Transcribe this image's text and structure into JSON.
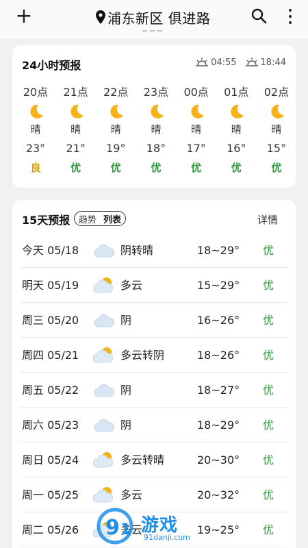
{
  "header": {
    "location": "浦东新区 俱进路"
  },
  "hourly": {
    "title": "24小时预报",
    "sunrise": "04:55",
    "sunset": "18:44",
    "hours": [
      {
        "time": "20点",
        "desc": "晴",
        "temp": "23°",
        "aqi": "良",
        "aqi_color": "#d4a200"
      },
      {
        "time": "21点",
        "desc": "晴",
        "temp": "21°",
        "aqi": "优",
        "aqi_color": "#2e9a3c"
      },
      {
        "time": "22点",
        "desc": "晴",
        "temp": "19°",
        "aqi": "优",
        "aqi_color": "#2e9a3c"
      },
      {
        "time": "23点",
        "desc": "晴",
        "temp": "18°",
        "aqi": "优",
        "aqi_color": "#2e9a3c"
      },
      {
        "time": "00点",
        "desc": "晴",
        "temp": "17°",
        "aqi": "优",
        "aqi_color": "#2e9a3c"
      },
      {
        "time": "01点",
        "desc": "晴",
        "temp": "16°",
        "aqi": "优",
        "aqi_color": "#2e9a3c"
      },
      {
        "time": "02点",
        "desc": "晴",
        "temp": "15°",
        "aqi": "优",
        "aqi_color": "#2e9a3c"
      }
    ]
  },
  "daily": {
    "title": "15天预报",
    "toggle_trend": "趋势",
    "toggle_list": "列表",
    "detail_label": "详情",
    "days": [
      {
        "date": "今天 05/18",
        "icon": "cloud-icon",
        "cond": "阴转晴",
        "temp": "18~29°",
        "aqi": "优"
      },
      {
        "date": "明天 05/19",
        "icon": "partly-cloudy-icon",
        "cond": "多云",
        "temp": "15~29°",
        "aqi": "优"
      },
      {
        "date": "周三 05/20",
        "icon": "cloud-icon",
        "cond": "阴",
        "temp": "16~26°",
        "aqi": "优"
      },
      {
        "date": "周四 05/21",
        "icon": "partly-cloudy-icon",
        "cond": "多云转阴",
        "temp": "18~26°",
        "aqi": "优"
      },
      {
        "date": "周五 05/22",
        "icon": "cloud-icon",
        "cond": "阴",
        "temp": "18~27°",
        "aqi": "优"
      },
      {
        "date": "周六 05/23",
        "icon": "cloud-icon",
        "cond": "阴",
        "temp": "18~29°",
        "aqi": "优"
      },
      {
        "date": "周日 05/24",
        "icon": "partly-cloudy-icon",
        "cond": "多云转晴",
        "temp": "20~30°",
        "aqi": "优"
      },
      {
        "date": "周一 05/25",
        "icon": "partly-cloudy-icon",
        "cond": "多云",
        "temp": "20~32°",
        "aqi": "优"
      },
      {
        "date": "周二 05/26",
        "icon": "partly-cloudy-icon",
        "cond": "多云",
        "temp": "19~25°",
        "aqi": "优"
      }
    ]
  },
  "watermark": {
    "brand": "游戏",
    "site": "91danji.com"
  },
  "colors": {
    "aqi_good": "#2e9a3c",
    "aqi_moderate": "#d4a200",
    "moon": "#f5b21a",
    "cloud": "#d8e6f3"
  }
}
